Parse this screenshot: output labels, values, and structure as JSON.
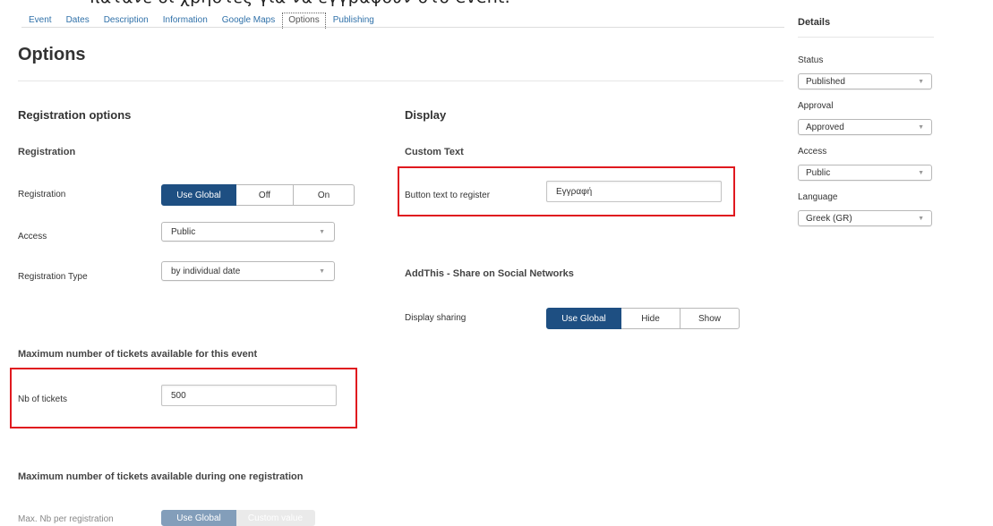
{
  "caption": "πατανε οι χρηστες για να εγγραφουν στο event.",
  "tabs": [
    "Event",
    "Dates",
    "Description",
    "Information",
    "Google Maps",
    "Options",
    "Publishing"
  ],
  "page_title": "Options",
  "registration_options": {
    "heading": "Registration options",
    "subheading": "Registration",
    "registration_label": "Registration",
    "registration_buttons": [
      "Use Global",
      "Off",
      "On"
    ],
    "access_label": "Access",
    "access_value": "Public",
    "type_label": "Registration Type",
    "type_value": "by individual date"
  },
  "max_tickets_event": {
    "heading": "Maximum number of tickets available for this event",
    "label": "Nb of tickets",
    "value": "500"
  },
  "max_tickets_registration": {
    "heading": "Maximum number of tickets available during one registration",
    "label": "Max. Nb per registration",
    "buttons": [
      "Use Global",
      "Custom value"
    ]
  },
  "display": {
    "heading": "Display",
    "custom_text_heading": "Custom Text",
    "button_text_label": "Button text to register",
    "button_text_value": "Εγγραφή",
    "addthis_heading": "AddThis - Share on Social Networks",
    "sharing_label": "Display sharing",
    "sharing_buttons": [
      "Use Global",
      "Hide",
      "Show"
    ]
  },
  "details": {
    "heading": "Details",
    "status_label": "Status",
    "status_value": "Published",
    "approval_label": "Approval",
    "approval_value": "Approved",
    "access_label": "Access",
    "access_value": "Public",
    "language_label": "Language",
    "language_value": "Greek (GR)"
  },
  "colors": {
    "accent": "#1e4f82",
    "link": "#3071a9",
    "highlight_box": "#e0191f"
  },
  "icons": {
    "select_caret": "caret-down-icon"
  }
}
